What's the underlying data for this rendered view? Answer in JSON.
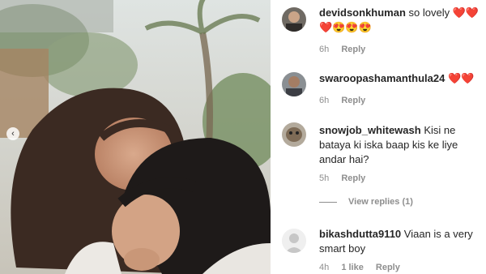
{
  "post": {
    "carousel_prev_icon": "chevron-left-icon"
  },
  "comments": [
    {
      "username": "devidsonkhuman",
      "text": "so lovely",
      "emoji": "❤️❤️❤️😍😍😍",
      "time": "6h",
      "reply": "Reply"
    },
    {
      "username": "swaroopashamanthula24",
      "text": "",
      "emoji": "❤️❤️",
      "time": "6h",
      "reply": "Reply"
    },
    {
      "username": "snowjob_whitewash",
      "text": "Kisi ne bataya ki iska baap kis ke liye andar hai?",
      "time": "5h",
      "reply": "Reply",
      "view_replies": "View replies (1)"
    },
    {
      "username": "bikashdutta9110",
      "text": "Viaan is a very smart boy",
      "time": "4h",
      "likes": "1 like",
      "reply": "Reply"
    }
  ]
}
